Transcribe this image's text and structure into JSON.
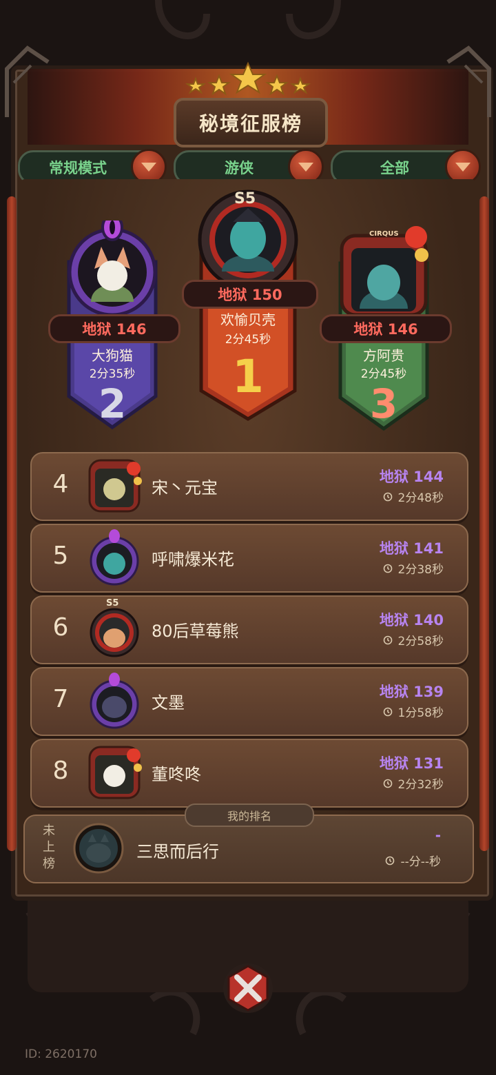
{
  "header": {
    "title": "秘境征服榜"
  },
  "filters": [
    {
      "label": "常规模式"
    },
    {
      "label": "游侠"
    },
    {
      "label": "全部"
    }
  ],
  "podium": [
    {
      "rank": "1",
      "season": "S5",
      "score": "地狱 150",
      "name": "欢愉贝壳",
      "time": "2分45秒"
    },
    {
      "rank": "2",
      "score": "地狱 146",
      "name": "大狗猫",
      "time": "2分35秒"
    },
    {
      "rank": "3",
      "frame": "CIRQUS",
      "score": "地狱 146",
      "name": "方阿贵",
      "time": "2分45秒"
    }
  ],
  "rows": [
    {
      "rank": "4",
      "name": "宋丶元宝",
      "score": "地狱 144",
      "time": "2分48秒"
    },
    {
      "rank": "5",
      "name": "呼啸爆米花",
      "score": "地狱 141",
      "time": "2分38秒"
    },
    {
      "rank": "6",
      "season": "S5",
      "name": "80后草莓熊",
      "score": "地狱 140",
      "time": "2分58秒"
    },
    {
      "rank": "7",
      "name": "文墨",
      "score": "地狱 139",
      "time": "1分58秒"
    },
    {
      "rank": "8",
      "name": "董咚咚",
      "score": "地狱 131",
      "time": "2分32秒"
    }
  ],
  "my_rank": {
    "tab_label": "我的排名",
    "status_line1": "未",
    "status_line2": "上",
    "status_line3": "榜",
    "name": "三思而后行",
    "score": "-",
    "time": "--分--秒"
  },
  "footer": {
    "id_text": "ID: 2620170"
  },
  "colors": {
    "score_purple": "#b784f0",
    "podium_score_red": "#ff6a5e",
    "filter_green": "#79d28c"
  }
}
